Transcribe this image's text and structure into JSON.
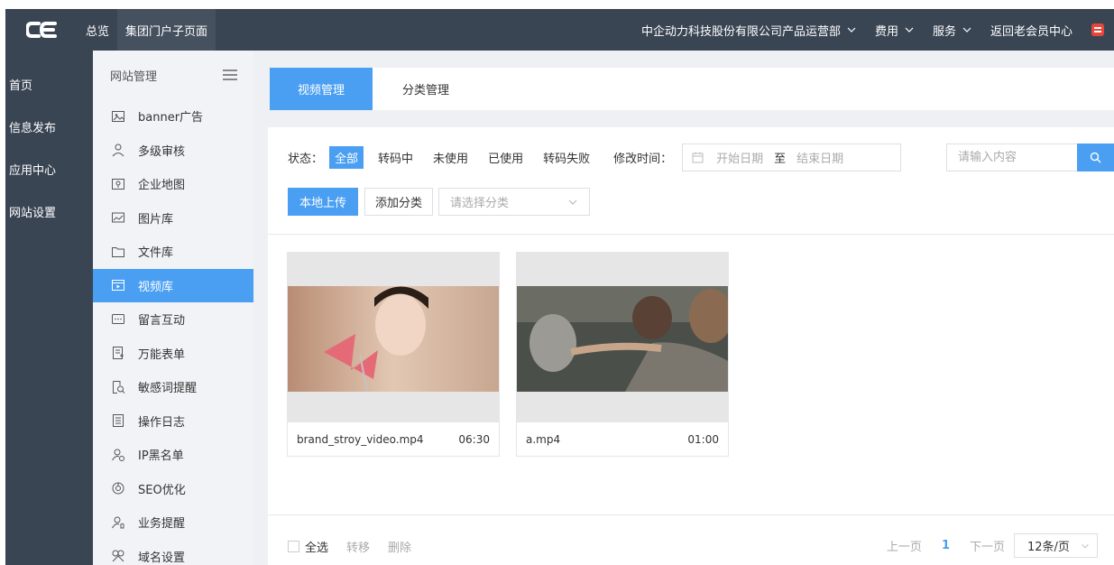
{
  "topbar": {
    "nav": [
      "总览",
      "集团门户子页面"
    ],
    "company": "中企动力科技股份有限公司产品运营部",
    "fee": "费用",
    "service": "服务",
    "back": "返回老会员中心"
  },
  "rail": [
    "首页",
    "信息发布",
    "应用中心",
    "网站设置"
  ],
  "menu": {
    "title": "网站管理",
    "items": [
      {
        "label": "banner广告",
        "icon": "image-frame-icon"
      },
      {
        "label": "多级审核",
        "icon": "user-icon"
      },
      {
        "label": "企业地图",
        "icon": "map-icon"
      },
      {
        "label": "图片库",
        "icon": "picture-icon"
      },
      {
        "label": "文件库",
        "icon": "folder-icon"
      },
      {
        "label": "视频库",
        "icon": "video-icon"
      },
      {
        "label": "留言互动",
        "icon": "chat-icon"
      },
      {
        "label": "万能表单",
        "icon": "form-icon"
      },
      {
        "label": "敏感词提醒",
        "icon": "search-doc-icon"
      },
      {
        "label": "操作日志",
        "icon": "log-icon"
      },
      {
        "label": "IP黑名单",
        "icon": "user-block-icon"
      },
      {
        "label": "SEO优化",
        "icon": "seo-icon"
      },
      {
        "label": "业务提醒",
        "icon": "user-bell-icon"
      },
      {
        "label": "域名设置",
        "icon": "domain-icon"
      }
    ],
    "active_index": 5
  },
  "tabs": [
    "视频管理",
    "分类管理"
  ],
  "filter": {
    "status_label": "状态：",
    "options": [
      "全部",
      "转码中",
      "未使用",
      "已使用",
      "转码失败"
    ],
    "time_label": "修改时间：",
    "start_placeholder": "开始日期",
    "sep": "至",
    "end_placeholder": "结束日期"
  },
  "search": {
    "placeholder": "请输入内容"
  },
  "actions": {
    "upload": "本地上传",
    "add_category": "添加分类",
    "select_placeholder": "请选择分类"
  },
  "videos": [
    {
      "name": "brand_stroy_video.mp4",
      "duration": "06:30"
    },
    {
      "name": "a.mp4",
      "duration": "01:00"
    }
  ],
  "bulk": {
    "select_all": "全选",
    "move": "转移",
    "delete": "删除"
  },
  "pager": {
    "prev": "上一页",
    "current": "1",
    "next": "下一页",
    "size": "12条/页"
  },
  "colors": {
    "topbar": "#3a4554",
    "accent": "#4a9ff2",
    "bg": "#eef0f3"
  }
}
